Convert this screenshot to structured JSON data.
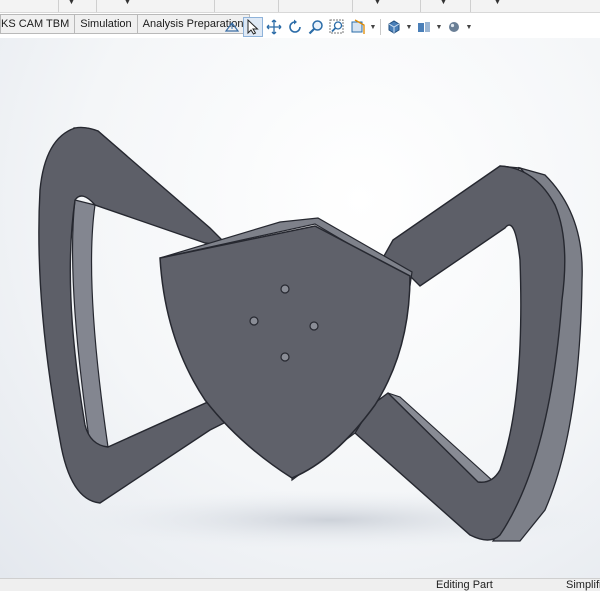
{
  "tabs": [
    "KS CAM TBM",
    "Simulation",
    "Analysis Preparation"
  ],
  "view_toolbar": {
    "icons": [
      "view-orientation-icon",
      "select-icon",
      "pan-icon",
      "rotate-icon",
      "zoom-icon",
      "zoom-area-icon",
      "section-view-icon",
      "display-style-icon",
      "hide-show-icon",
      "appearance-icon"
    ]
  },
  "status": {
    "editing": "Editing Part",
    "right": "Simplifi"
  },
  "colors": {
    "part_face": "#5d5f68",
    "part_side": "#7d8089",
    "part_edge": "#262830",
    "background": "#f4f6f8"
  }
}
